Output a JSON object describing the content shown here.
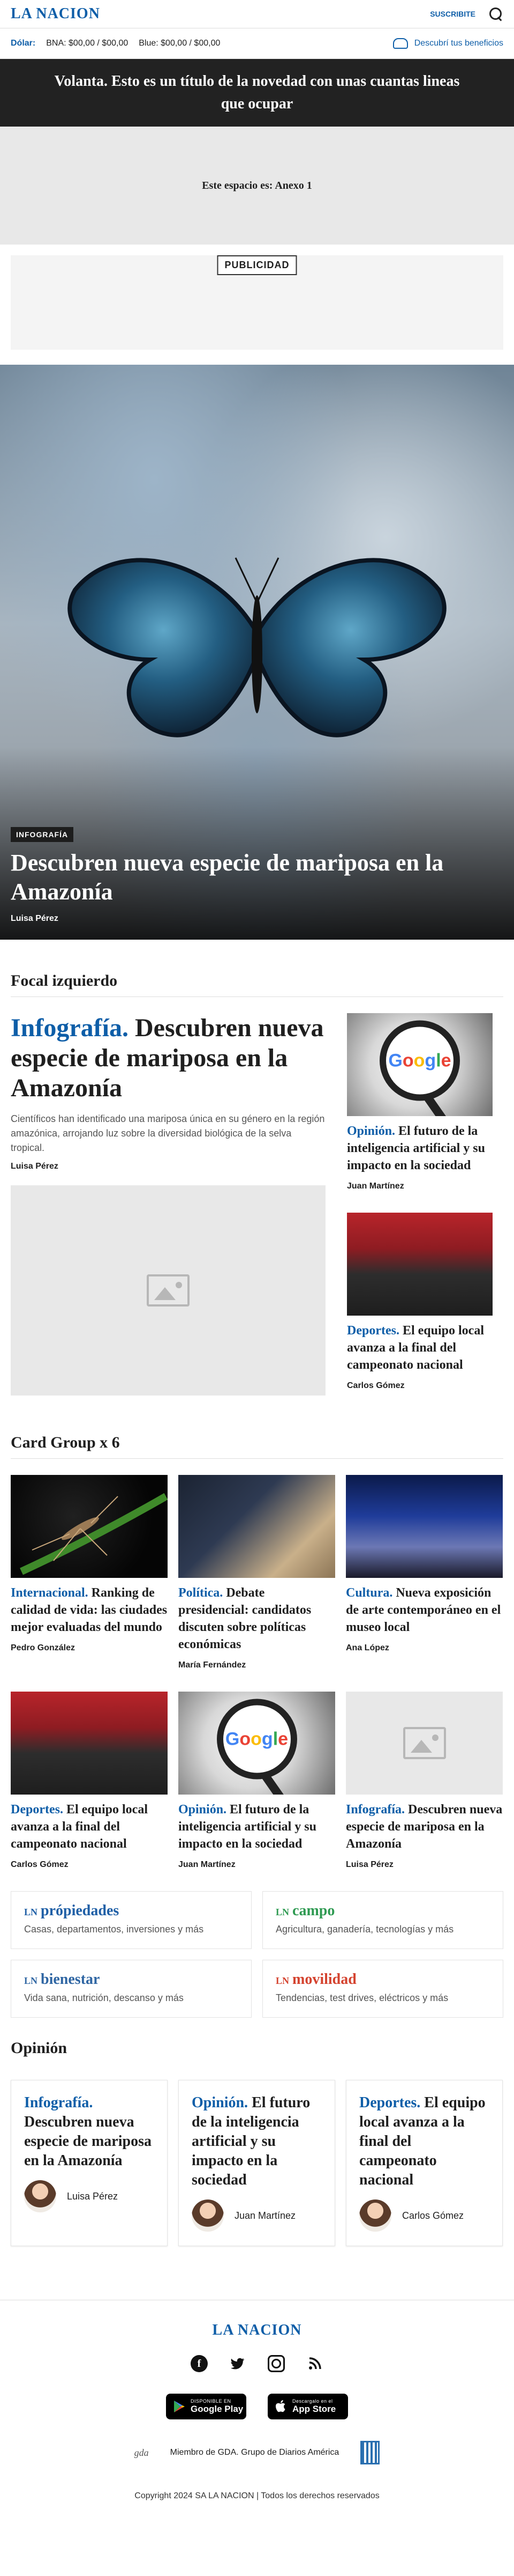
{
  "header": {
    "logo": "LA NACION",
    "subscribe": "SUSCRIBITE"
  },
  "dolar": {
    "label": "Dólar:",
    "bna": "BNA: $00,00 / $00,00",
    "blue": "Blue: $00,00 / $00,00",
    "benefits": "Descubrí tus beneficios"
  },
  "volanta": {
    "text": "Volanta. Esto es un título de la novedad con unas cuantas lineas que ocupar"
  },
  "anexo": {
    "text": "Este espacio es: Anexo 1"
  },
  "ad": {
    "label": "PUBLICIDAD"
  },
  "hero": {
    "category": "INFOGRAFÍA",
    "title": "Descubren nueva especie de mariposa en la Amazonía",
    "author": "Luisa Pérez"
  },
  "focal": {
    "section_title": "Focal izquierdo",
    "main": {
      "kicker": "Infografía.",
      "title": "Descubren nueva especie de mariposa en la Amazonía",
      "description": "Científicos han identificado una mariposa única en su género en la región amazónica, arrojando luz sobre la diversidad biológica de la selva tropical.",
      "author": "Luisa Pérez"
    },
    "side": [
      {
        "kicker": "Opinión.",
        "title": "El futuro de la inteligencia artificial y su impacto en la sociedad",
        "author": "Juan Martínez",
        "image": "google"
      },
      {
        "kicker": "Deportes.",
        "title": "El equipo local avanza a la final del campeonato nacional",
        "author": "Carlos Gómez",
        "image": "stadium"
      }
    ]
  },
  "cardgroup": {
    "section_title": "Card Group x 6",
    "cards": [
      {
        "kicker": "Internacional.",
        "title": "Ranking de calidad de vida: las ciudades mejor evaluadas del mundo",
        "author": "Pedro González",
        "image": "mosquito"
      },
      {
        "kicker": "Política.",
        "title": "Debate presidencial: candidatos discuten sobre políticas económicas",
        "author": "María Fernández",
        "image": "politics"
      },
      {
        "kicker": "Cultura.",
        "title": "Nueva exposición de arte contemporáneo en el museo local",
        "author": "Ana López",
        "image": "culture"
      },
      {
        "kicker": "Deportes.",
        "title": "El equipo local avanza a la final del campeonato nacional",
        "author": "Carlos Gómez",
        "image": "stadium"
      },
      {
        "kicker": "Opinión.",
        "title": "El futuro de la inteligencia artificial y su impacto en la sociedad",
        "author": "Juan Martínez",
        "image": "google"
      },
      {
        "kicker": "Infografía.",
        "title": "Descubren nueva especie de mariposa en la Amazonía",
        "author": "Luisa Pérez",
        "image": "placeholder"
      }
    ]
  },
  "verticals": [
    {
      "prefix": "LN",
      "name": "própiedades",
      "description": "Casas, departamentos, inversiones y más",
      "color": "#1f5fa6"
    },
    {
      "prefix": "LN",
      "name": "campo",
      "description": "Agricultura, ganadería, tecnologías y más",
      "color": "#2f9a52"
    },
    {
      "prefix": "LN",
      "name": "bienestar",
      "description": "Vida sana, nutrición, descanso y más",
      "color": "#2f66a3"
    },
    {
      "prefix": "LN",
      "name": "movilidad",
      "description": "Tendencias, test drives, eléctricos y más",
      "color": "#d4432f"
    }
  ],
  "opinion": {
    "section_title": "Opinión",
    "cards": [
      {
        "kicker": "Infografía.",
        "title": "Descubren nueva especie de mariposa en la Amazonía",
        "author": "Luisa Pérez"
      },
      {
        "kicker": "Opinión.",
        "title": "El futuro de la inteligencia artificial y su impacto en la sociedad",
        "author": "Juan Martínez"
      },
      {
        "kicker": "Deportes.",
        "title": "El equipo local avanza a la final del campeonato nacional",
        "author": "Carlos Gómez"
      }
    ]
  },
  "footer": {
    "logo": "LA NACION",
    "google_play_small": "DISPONIBLE EN",
    "google_play": "Google Play",
    "app_store_small": "Descargalo en el",
    "app_store": "App Store",
    "gda_logo": "gda",
    "gda_text": "Miembro de GDA. Grupo de Diarios América",
    "copyright": "Copyright 2024 SA LA NACION | Todos los derechos reservados"
  },
  "colors": {
    "brand": "#0e5ea8",
    "kicker": "#0e5ea8",
    "dark_bar": "#222222"
  }
}
